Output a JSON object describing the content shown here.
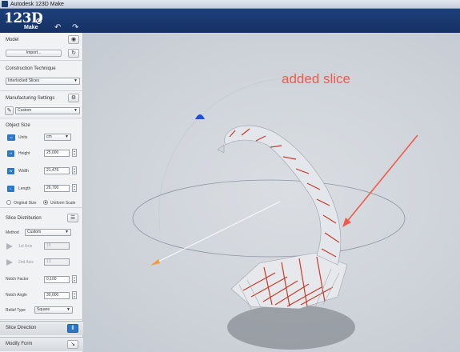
{
  "window": {
    "title": "Autodesk 123D Make"
  },
  "brand": {
    "name": "123D",
    "sub": "Make"
  },
  "model": {
    "header": "Model",
    "import_label": "Import..."
  },
  "construction": {
    "header": "Construction Technique",
    "value": "Interlocked Slices"
  },
  "manufacturing": {
    "header": "Manufacturing Settings",
    "value": "Custom"
  },
  "object_size": {
    "header": "Object Size",
    "units_label": "Units",
    "units_value": "cm",
    "height_label": "Height",
    "height_value": "25,000",
    "width_label": "Width",
    "width_value": "21,476",
    "length_label": "Length",
    "length_value": "26,700",
    "original_size_label": "Original Size",
    "uniform_scale_label": "Uniform Scale"
  },
  "slice_distribution": {
    "header": "Slice Distribution",
    "method_label": "Method",
    "method_value": "Custom",
    "axis1_label": "1st Axis",
    "axis1_value": "15",
    "axis2_label": "2nd Axis",
    "axis2_value": "13",
    "notch_factor_label": "Notch Factor",
    "notch_factor_value": "0,100",
    "notch_angle_label": "Notch Angle",
    "notch_angle_value": "30,000",
    "relief_type_label": "Relief Type",
    "relief_type_value": "Square"
  },
  "footer": {
    "slice_direction_label": "Slice Direction",
    "modify_form_label": "Modify Form"
  },
  "annotation": {
    "text": "added slice",
    "color": "#f05a4a"
  },
  "colors": {
    "brand": "#1a3a74",
    "slice_red": "#c73b2a",
    "orbit_blue": "#1f4fd8",
    "orbit_handle": "#f29a3c"
  }
}
